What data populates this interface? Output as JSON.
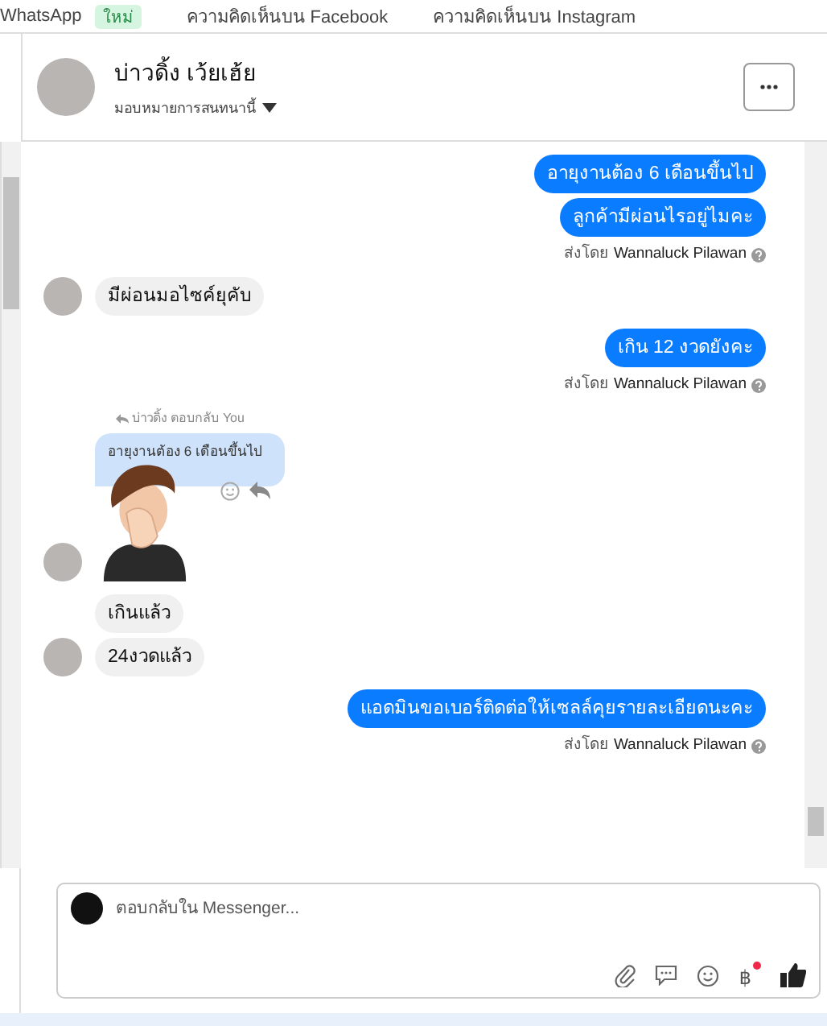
{
  "top_tabs": [
    {
      "label": "WhatsApp",
      "badge": "ใหม่"
    },
    {
      "label": "ความคิดเห็นบน Facebook"
    },
    {
      "label": "ความคิดเห็นบน Instagram"
    }
  ],
  "header": {
    "name": "บ่าวดิ้ง เว้ยเฮ้ย",
    "subtitle": "มอบหมายการสนทนานี้"
  },
  "messages": [
    {
      "kind": "outgoing",
      "bubbles": [
        "อายุงานต้อง 6 เดือนขึ้นไป",
        "ลูกค้ามีผ่อนไรอยู่ไมคะ"
      ],
      "sent_by": "ส่งโดย",
      "sender": "Wannaluck Pilawan"
    },
    {
      "kind": "incoming",
      "bubbles": [
        "มีผ่อนมอไซค์ยุคับ"
      ]
    },
    {
      "kind": "outgoing",
      "bubbles": [
        "เกิน 12 งวดยังคะ"
      ],
      "sent_by": "ส่งโดย",
      "sender": "Wannaluck Pilawan"
    },
    {
      "kind": "sticker_reply",
      "reply_label": "บ่าวดิ้ง ตอบกลับ You",
      "quoted": "อายุงานต้อง 6 เดือนขึ้นไป"
    },
    {
      "kind": "incoming",
      "bubbles": [
        "เกินแล้ว",
        "24งวดแล้ว"
      ]
    },
    {
      "kind": "outgoing",
      "bubbles": [
        "แอดมินขอเบอร์ติดต่อให้เซลล์คุยรายละเอียดนะคะ"
      ],
      "sent_by": "ส่งโดย",
      "sender": "Wannaluck Pilawan"
    }
  ],
  "composer": {
    "placeholder": "ตอบกลับใน Messenger...",
    "currency": "฿"
  }
}
